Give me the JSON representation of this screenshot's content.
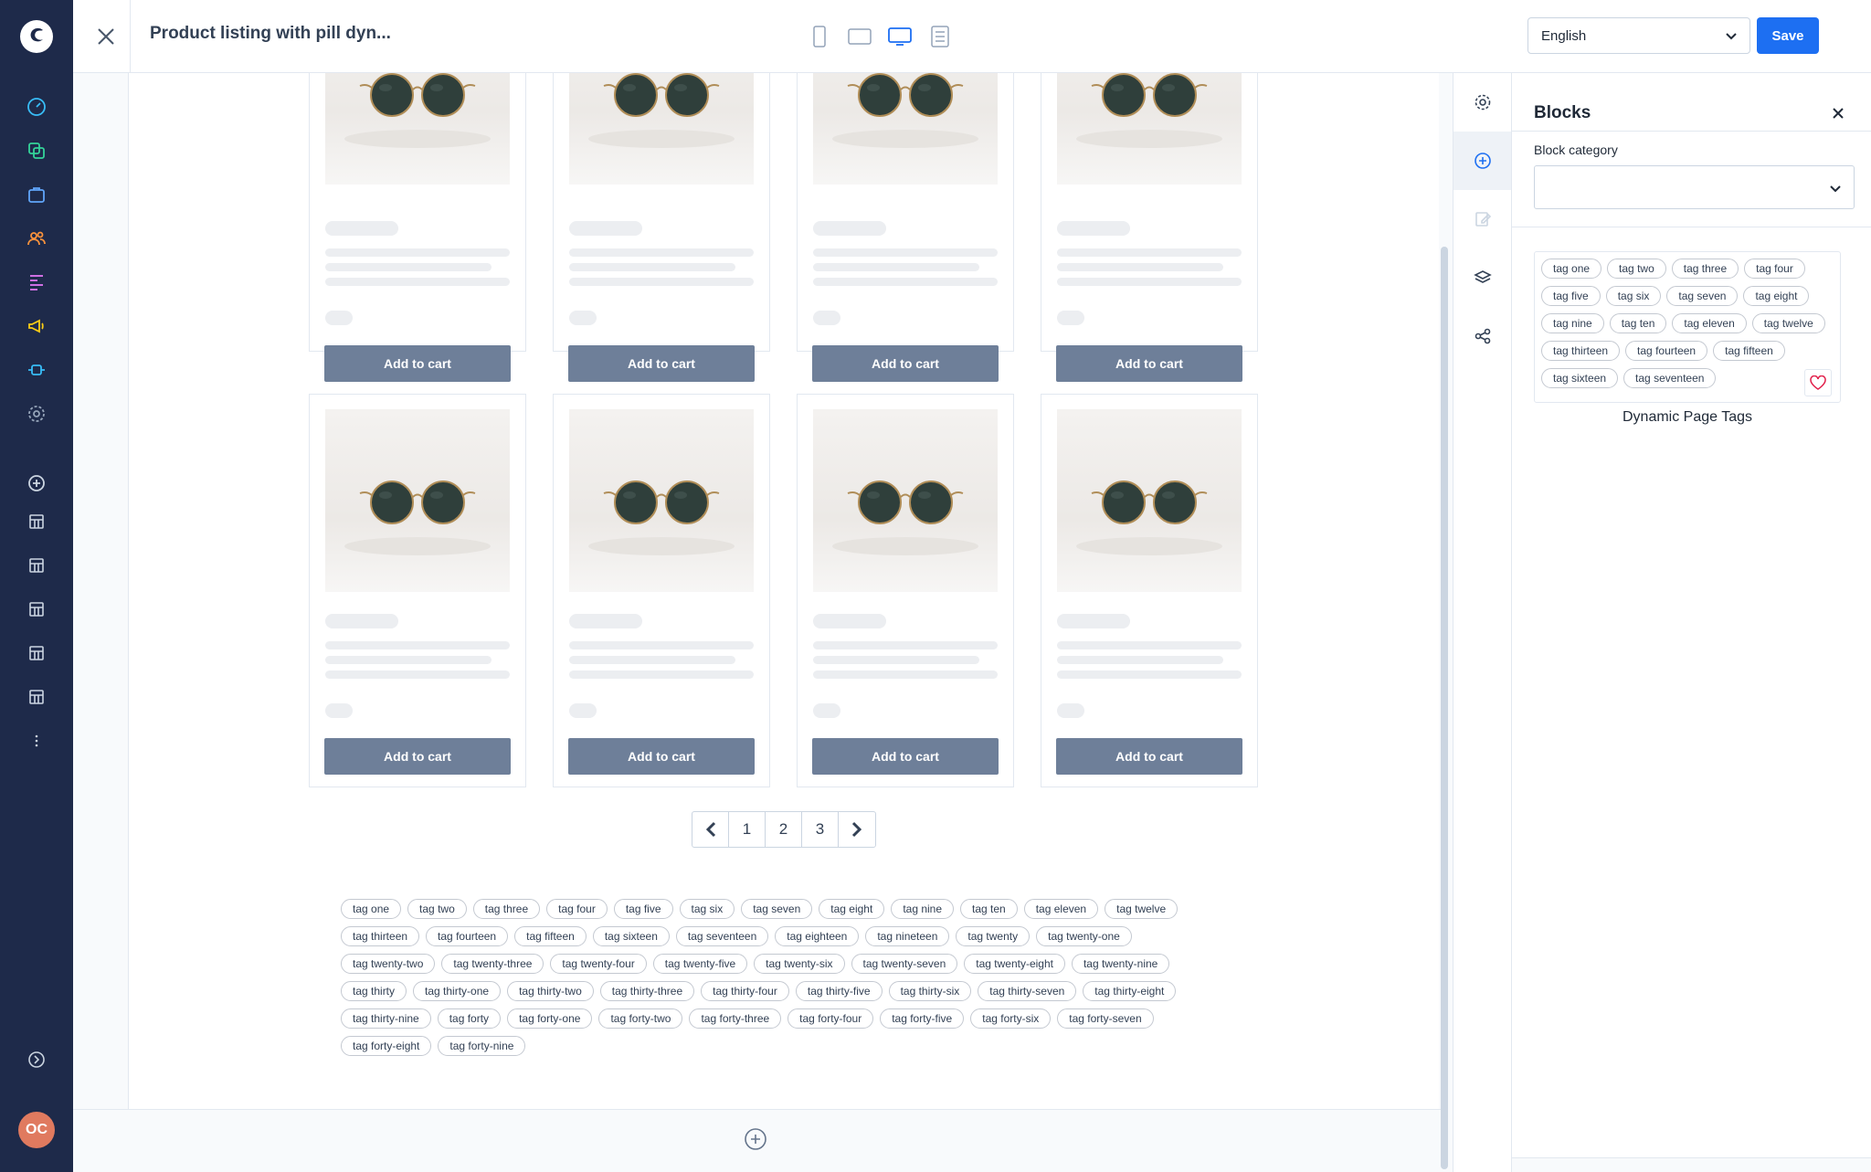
{
  "app": {
    "title": "Product listing with pill dyn...",
    "user_initials": "OC",
    "language": "English",
    "save_label": "Save"
  },
  "sidebar": {
    "items": [
      "dashboard-icon",
      "catalog-icon",
      "orders-icon",
      "customers-icon",
      "content-icon",
      "marketing-icon",
      "extensions-icon",
      "settings-icon",
      "add-sales-channel-icon",
      "sales-channel-icon",
      "sales-channel-icon",
      "sales-channel-icon",
      "sales-channel-icon",
      "sales-channel-icon",
      "more-icon"
    ]
  },
  "products": {
    "cart_label": "Add to cart",
    "rows": 2,
    "cols": 4
  },
  "pagination": {
    "pages": [
      "1",
      "2",
      "3"
    ]
  },
  "tags": [
    "tag one",
    "tag two",
    "tag three",
    "tag four",
    "tag five",
    "tag six",
    "tag seven",
    "tag eight",
    "tag nine",
    "tag ten",
    "tag eleven",
    "tag twelve",
    "tag thirteen",
    "tag fourteen",
    "tag fifteen",
    "tag sixteen",
    "tag seventeen",
    "tag eighteen",
    "tag nineteen",
    "tag twenty",
    "tag twenty-one",
    "tag twenty-two",
    "tag twenty-three",
    "tag twenty-four",
    "tag twenty-five",
    "tag twenty-six",
    "tag twenty-seven",
    "tag twenty-eight",
    "tag twenty-nine",
    "tag thirty",
    "tag thirty-one",
    "tag thirty-two",
    "tag thirty-three",
    "tag thirty-four",
    "tag thirty-five",
    "tag thirty-six",
    "tag thirty-seven",
    "tag thirty-eight",
    "tag thirty-nine",
    "tag forty",
    "tag forty-one",
    "tag forty-two",
    "tag forty-three",
    "tag forty-four",
    "tag forty-five",
    "tag forty-six",
    "tag forty-seven",
    "tag forty-eight",
    "tag forty-nine"
  ],
  "panel": {
    "title": "Blocks",
    "category_label": "Block category",
    "category_value": "",
    "preview_tags": [
      "tag one",
      "tag two",
      "tag three",
      "tag four",
      "tag five",
      "tag six",
      "tag seven",
      "tag eight",
      "tag nine",
      "tag ten",
      "tag eleven",
      "tag twelve",
      "tag thirteen",
      "tag fourteen",
      "tag fifteen",
      "tag sixteen",
      "tag seventeen"
    ],
    "preview_label": "Dynamic Page Tags"
  },
  "colors": {
    "sidebar": "#1e2a4a",
    "accent": "#1d6ff2",
    "cart_button": "#6e7f99"
  }
}
